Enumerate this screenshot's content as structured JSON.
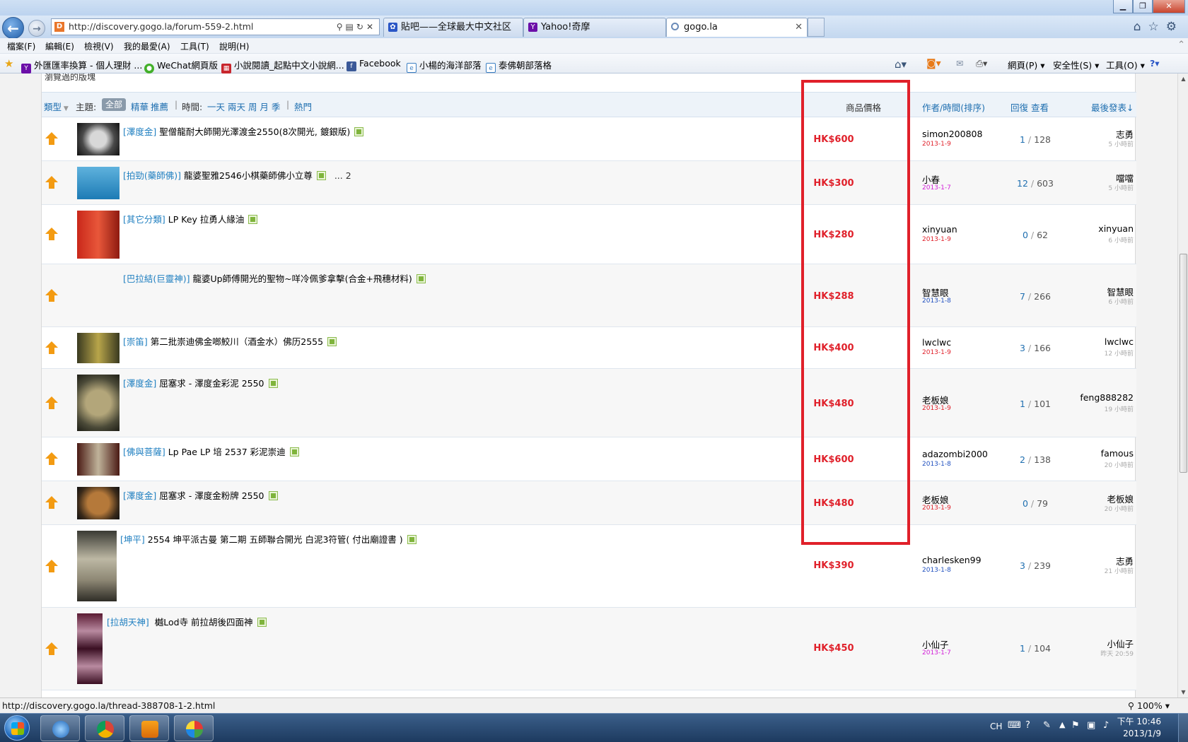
{
  "browser": {
    "address": "http://discovery.gogo.la/forum-559-2.html",
    "tabs": [
      {
        "label": "貼吧——全球最大中文社区"
      },
      {
        "label": "Yahoo!奇摩"
      },
      {
        "label": "gogo.la"
      }
    ],
    "menu": [
      "檔案(F)",
      "編輯(E)",
      "檢視(V)",
      "我的最愛(A)",
      "工具(T)",
      "說明(H)"
    ],
    "favorites": [
      {
        "label": "外匯匯率換算 - 個人理財 ...",
        "icon": "yahoo-icon",
        "color": "#6b0fa8"
      },
      {
        "label": "WeChat網頁版",
        "icon": "wechat-icon",
        "color": "#43b02a"
      },
      {
        "label": "小說閱讀_起點中文小說網...",
        "icon": "qidian-icon",
        "color": "#c8262d"
      },
      {
        "label": "Facebook",
        "icon": "facebook-icon",
        "color": "#3b5998"
      },
      {
        "label": "小楊的海洋部落",
        "icon": "page-icon",
        "color": "#3c7fc2"
      },
      {
        "label": "泰佛朝部落格",
        "icon": "page-icon",
        "color": "#3c7fc2"
      }
    ],
    "commands": [
      "網頁(P)",
      "安全性(S)",
      "工具(O)"
    ],
    "status_url": "http://discovery.gogo.la/thread-388708-1-2.html",
    "zoom": "100%"
  },
  "page": {
    "cut_text": "瀏覽過的版塊",
    "filter": {
      "type_label": "類型",
      "theme_label": "主題:",
      "all": "全部",
      "digest": "精華",
      "recommend": "推薦",
      "time_label": "時間:",
      "time_options": "一天 兩天 周 月 季",
      "hot": "熱門"
    },
    "headers": {
      "price": "商品價格",
      "author": "作者/時間(排序)",
      "replies": "回復 查看",
      "last_post": "最後發表↓"
    },
    "threads": [
      {
        "category": "[澤度金]",
        "title": "聖僧龍耐大師開光澤渡金2550(8次開光, 鍍銀版)",
        "price": "HK$600",
        "author": "simon200808",
        "date": "2013-1-9",
        "date_color": "#e0212b",
        "replies": "1",
        "views": "128",
        "last_user": "志勇",
        "last_time": "5 小時前",
        "thumb_color": "#8f8f8f"
      },
      {
        "category": "[拍勁(藥師佛)]",
        "title": "龍婆聖雅2546小棋藥師佛小立尊",
        "suffix": "... 2",
        "price": "HK$300",
        "author": "小春",
        "date": "2013-1-7",
        "date_color": "#d21ed8",
        "replies": "12",
        "views": "603",
        "last_user": "噹噹",
        "last_time": "5 小時前",
        "thumb_color": "#2a8fc4"
      },
      {
        "category": "[其它分類]",
        "title": "LP Key 拉勇人緣油",
        "price": "HK$280",
        "author": "xinyuan",
        "date": "2013-1-9",
        "date_color": "#e0212b",
        "replies": "0",
        "views": "62",
        "last_user": "xinyuan",
        "last_time": "6 小時前",
        "thumb_color": "#c42818"
      },
      {
        "category": "[巴拉結(巨靈神)]",
        "title": "龍婆Up師傅開光的聖物~咩冷佩爹拿擊(合金+飛穗材料)",
        "price": "HK$288",
        "author": "智慧眼",
        "date": "2013-1-8",
        "date_color": "#1f4fbf",
        "replies": "7",
        "views": "266",
        "last_user": "智慧眼",
        "last_time": "6 小時前",
        "thumb_color": ""
      },
      {
        "category": "[崇笛]",
        "title": "第二批崇迪佛金啷鮫川（酒金水）佛历2555",
        "price": "HK$400",
        "author": "lwclwc",
        "date": "2013-1-9",
        "date_color": "#e0212b",
        "replies": "3",
        "views": "166",
        "last_user": "lwclwc",
        "last_time": "12 小時前",
        "thumb_color": "#8a7a2e"
      },
      {
        "category": "[澤度金]",
        "title": "屈塞求 - 澤度金彩泥 2550",
        "price": "HK$480",
        "author": "老板娘",
        "date": "2013-1-9",
        "date_color": "#e0212b",
        "replies": "1",
        "views": "101",
        "last_user": "feng888282",
        "last_time": "19 小時前",
        "thumb_color": "#6d6a4a"
      },
      {
        "category": "[佛與菩薩]",
        "title": "Lp Pae LP 培 2537 彩泥崇迪",
        "price": "HK$600",
        "author": "adazombi2000",
        "date": "2013-1-8",
        "date_color": "#1f4fbf",
        "replies": "2",
        "views": "138",
        "last_user": "famous",
        "last_time": "20 小時前",
        "thumb_color": "#5a2a20"
      },
      {
        "category": "[澤度金]",
        "title": "屈塞求 - 澤度金粉牌 2550",
        "price": "HK$480",
        "author": "老板娘",
        "date": "2013-1-9",
        "date_color": "#e0212b",
        "replies": "0",
        "views": "79",
        "last_user": "老板娘",
        "last_time": "20 小時前",
        "thumb_color": "#7a5a30"
      },
      {
        "category": "[坤平]",
        "title": "2554 坤平派古曼 第二期 五師聯合開光 白泥3符管( 付出廟證書 )",
        "price": "HK$390",
        "author": "charlesken99",
        "date": "2013-1-8",
        "date_color": "#1f4fbf",
        "replies": "3",
        "views": "239",
        "last_user": "志勇",
        "last_time": "21 小時前",
        "thumb_color": "#9a9686"
      },
      {
        "category": "[拉胡天神]",
        "title": "  樾Lod寺 前拉胡後四面神",
        "price": "HK$450",
        "author": "小仙子",
        "date": "2013-1-7",
        "date_color": "#d21ed8",
        "replies": "1",
        "views": "104",
        "last_user": "小仙子",
        "last_time": "昨天 20:59",
        "thumb_color": "#5a1a30"
      }
    ]
  },
  "taskbar": {
    "lang": "CH",
    "time": "下午 10:46",
    "date": "2013/1/9"
  }
}
